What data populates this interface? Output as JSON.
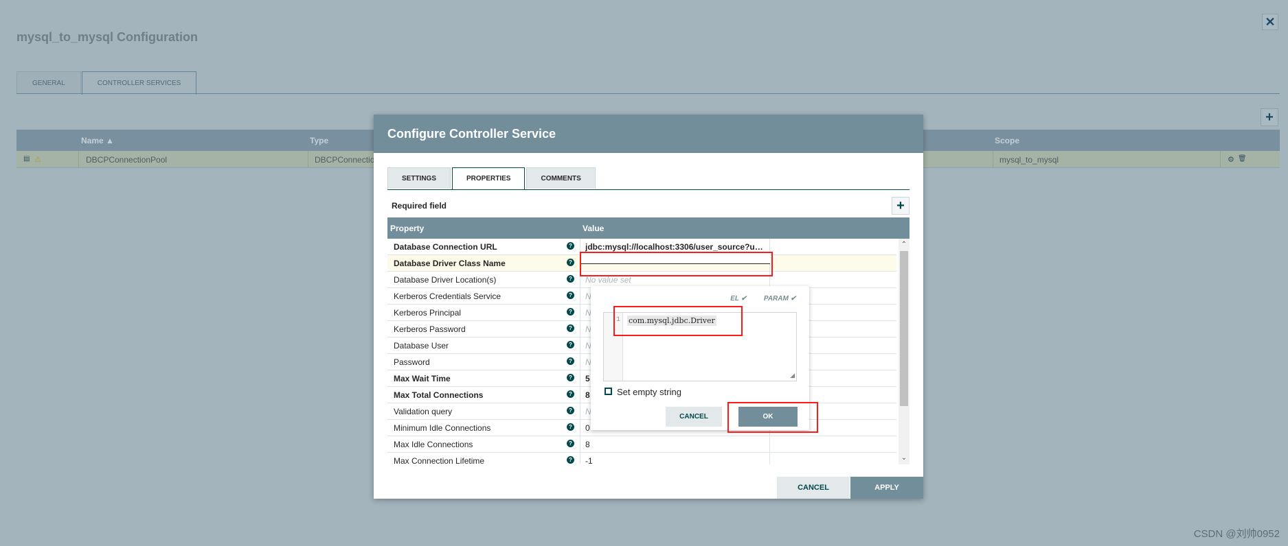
{
  "background": {
    "title": "mysql_to_mysql Configuration",
    "tabs": [
      "GENERAL",
      "CONTROLLER SERVICES"
    ],
    "active_tab": "CONTROLLER SERVICES",
    "columns": {
      "name": "Name ▲",
      "type": "Type",
      "scope": "Scope"
    },
    "row": {
      "name": "DBCPConnectionPool",
      "type": "DBCPConnectio",
      "scope": "mysql_to_mysql"
    }
  },
  "dialog": {
    "title": "Configure Controller Service",
    "tabs": [
      "SETTINGS",
      "PROPERTIES",
      "COMMENTS"
    ],
    "active_tab": "PROPERTIES",
    "required_label": "Required field",
    "columns": {
      "property": "Property",
      "value": "Value"
    },
    "properties": [
      {
        "name": "Database Connection URL",
        "bold": true,
        "value": "jdbc:mysql://localhost:3306/user_source?useU...",
        "value_bold": true
      },
      {
        "name": "Database Driver Class Name",
        "bold": true,
        "value": "",
        "selected": true
      },
      {
        "name": "Database Driver Location(s)",
        "bold": false,
        "value": "No value set",
        "placeholder": true
      },
      {
        "name": "Kerberos Credentials Service",
        "bold": false,
        "value": "N",
        "placeholder": true
      },
      {
        "name": "Kerberos Principal",
        "bold": false,
        "value": "N",
        "placeholder": true
      },
      {
        "name": "Kerberos Password",
        "bold": false,
        "value": "N",
        "placeholder": true
      },
      {
        "name": "Database User",
        "bold": false,
        "value": "N",
        "placeholder": true
      },
      {
        "name": "Password",
        "bold": false,
        "value": "N",
        "placeholder": true
      },
      {
        "name": "Max Wait Time",
        "bold": true,
        "value": "5",
        "value_bold": true
      },
      {
        "name": "Max Total Connections",
        "bold": true,
        "value": "8",
        "value_bold": true
      },
      {
        "name": "Validation query",
        "bold": false,
        "value": "N",
        "placeholder": true
      },
      {
        "name": "Minimum Idle Connections",
        "bold": false,
        "value": "0"
      },
      {
        "name": "Max Idle Connections",
        "bold": false,
        "value": "8"
      },
      {
        "name": "Max Connection Lifetime",
        "bold": false,
        "value": "-1"
      }
    ],
    "cancel_label": "CANCEL",
    "apply_label": "APPLY"
  },
  "editor_popup": {
    "el_label": "EL ✔",
    "param_label": "PARAM ✔",
    "line_number": "1",
    "code": "com.mysql.jdbc.Driver",
    "empty_string_label": "Set empty string",
    "cancel_label": "CANCEL",
    "ok_label": "OK"
  },
  "watermark": "CSDN @刘帅0952",
  "colors": {
    "accent": "#728e9b",
    "dark": "#004849",
    "highlight": "#ff1a1a"
  }
}
